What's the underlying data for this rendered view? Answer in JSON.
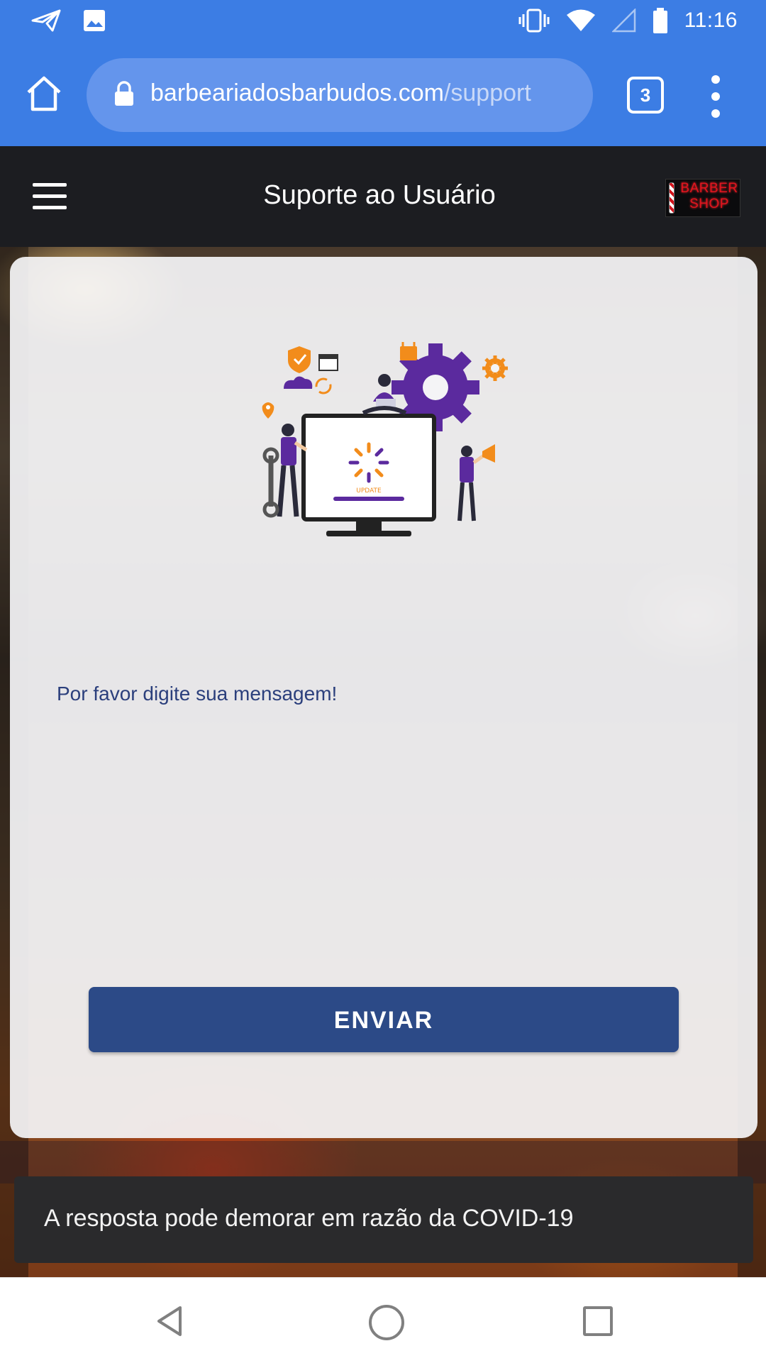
{
  "status_bar": {
    "time": "11:16",
    "left_icons": [
      "send-icon",
      "image-icon"
    ],
    "right_icons": [
      "vibrate-icon",
      "wifi-icon",
      "signal-icon",
      "battery-icon"
    ]
  },
  "browser": {
    "url_domain": "barbeariadosbarbudos.com",
    "url_path": "/support",
    "tab_count": "3"
  },
  "app_header": {
    "title": "Suporte ao Usuário",
    "logo_line1": "BARBER",
    "logo_line2": "SHOP"
  },
  "card": {
    "illustration_label": "UPDATE",
    "prompt": "Por favor digite sua mensagem!",
    "send_label": "ENVIAR"
  },
  "snackbar": {
    "message": "A resposta pode demorar em razão da COVID-19"
  },
  "colors": {
    "chrome_blue": "#3c7de4",
    "header_dark": "#1c1d21",
    "button_blue": "#2c4a87",
    "accent_purple": "#5b2a9e",
    "accent_orange": "#f28c1b"
  }
}
